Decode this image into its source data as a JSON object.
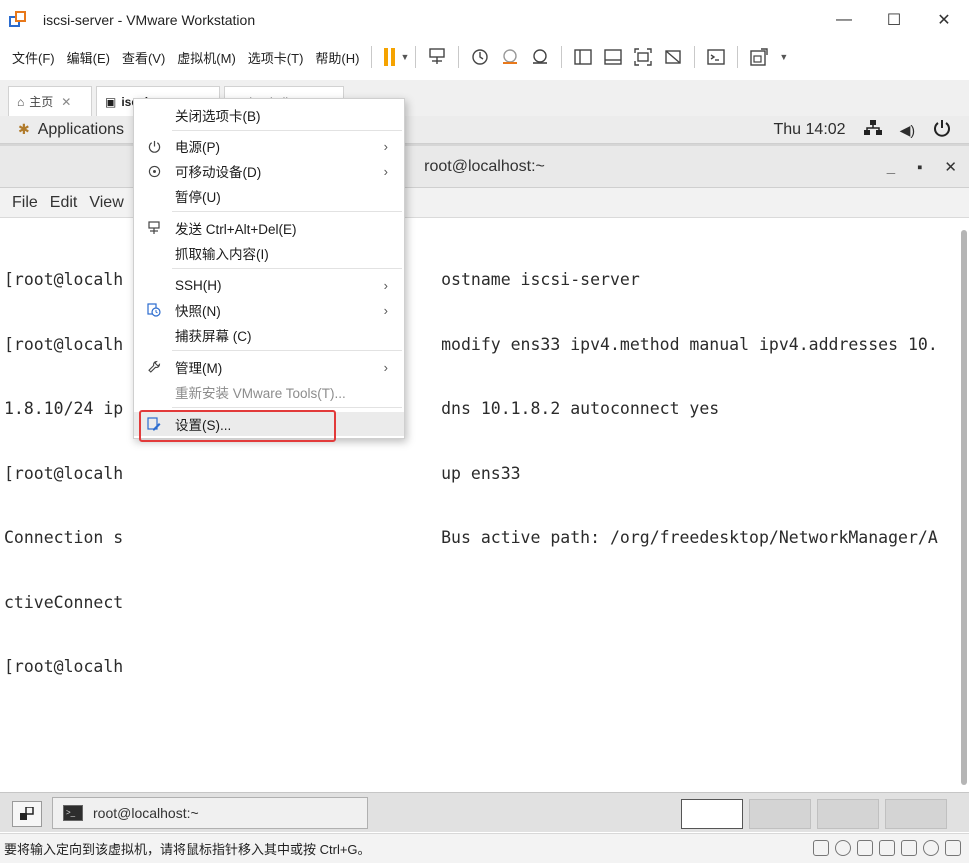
{
  "window": {
    "title": "iscsi-server - VMware Workstation",
    "controls": {
      "minimize": "—",
      "maximize": "☐",
      "close": "✕"
    }
  },
  "menubar": {
    "items": [
      "文件(F)",
      "编辑(E)",
      "查看(V)",
      "虚拟机(M)",
      "选项卡(T)",
      "帮助(H)"
    ]
  },
  "tabs": [
    {
      "label": "主页",
      "icon": "home-icon"
    },
    {
      "label": "iscsi-server",
      "icon": "vm-icon"
    },
    {
      "label": "iscsi-client",
      "icon": "vm-icon"
    }
  ],
  "gnome": {
    "applications": "Applications",
    "clock": "Thu 14:02",
    "icons": [
      "network-icon",
      "volume-icon",
      "power-icon"
    ]
  },
  "terminal": {
    "title": "root@localhost:~",
    "menu": [
      "File",
      "Edit",
      "View"
    ],
    "lines": [
      "[root@localh                                ostname iscsi-server",
      "[root@localh                                modify ens33 ipv4.method manual ipv4.addresses 10.",
      "1.8.10/24 ip                                dns 10.1.8.2 autoconnect yes",
      "[root@localh                                up ens33",
      "Connection s                                Bus active path: /org/freedesktop/NetworkManager/A",
      "ctiveConnect",
      "[root@localh"
    ]
  },
  "guest_taskbar": {
    "task_label": "root@localhost:~"
  },
  "context_menu": {
    "items": [
      {
        "label": "关闭选项卡(B)",
        "icon": "",
        "submenu": false,
        "disabled": false
      },
      {
        "label": "电源(P)",
        "icon": "power-icon",
        "submenu": true,
        "disabled": false
      },
      {
        "label": "可移动设备(D)",
        "icon": "removable-device-icon",
        "submenu": true,
        "disabled": false
      },
      {
        "label": "暂停(U)",
        "icon": "",
        "submenu": false,
        "disabled": false
      },
      {
        "label": "发送 Ctrl+Alt+Del(E)",
        "icon": "send-keys-icon",
        "submenu": false,
        "disabled": false
      },
      {
        "label": "抓取输入内容(I)",
        "icon": "",
        "submenu": false,
        "disabled": false
      },
      {
        "label": "SSH(H)",
        "icon": "",
        "submenu": true,
        "disabled": false
      },
      {
        "label": "快照(N)",
        "icon": "snapshot-icon",
        "submenu": true,
        "disabled": false
      },
      {
        "label": "捕获屏幕 (C)",
        "icon": "",
        "submenu": false,
        "disabled": false
      },
      {
        "label": "管理(M)",
        "icon": "wrench-icon",
        "submenu": true,
        "disabled": false
      },
      {
        "label": "重新安装 VMware Tools(T)...",
        "icon": "",
        "submenu": false,
        "disabled": true
      },
      {
        "label": "设置(S)...",
        "icon": "settings-icon",
        "submenu": false,
        "disabled": false
      }
    ],
    "highlight_color": "#e23a3a"
  },
  "statusbar": {
    "message": "要将输入定向到该虚拟机，请将鼠标指针移入其中或按 Ctrl+G。"
  },
  "colors": {
    "accent_orange": "#f5a300",
    "vmware_orange": "#e8781a",
    "vmware_blue": "#2b6ccf"
  }
}
